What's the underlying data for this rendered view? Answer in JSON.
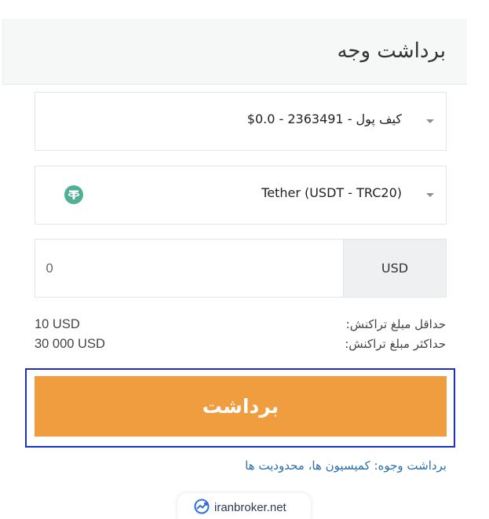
{
  "header": {
    "title": "برداشت وجه"
  },
  "wallet_select": {
    "value": "کیف پول - 2363491 - 0.0$"
  },
  "method_select": {
    "value": "Tether (USDT - TRC20)",
    "icon": "tether-icon",
    "icon_color": "#50af95"
  },
  "amount": {
    "placeholder": "0",
    "currency": "USD"
  },
  "limits": {
    "min_label": "حداقل مبلغ تراکنش:",
    "min_value": "10 USD",
    "max_label": "حداکثر مبلغ تراکنش:",
    "max_value": "30 000 USD"
  },
  "submit": {
    "label": "برداشت",
    "color": "#ef9d3f"
  },
  "footer": {
    "link_text": "برداشت وجوه: کمیسیون ها، محدودیت ها"
  },
  "watermark": {
    "text": "iranbroker.net"
  }
}
